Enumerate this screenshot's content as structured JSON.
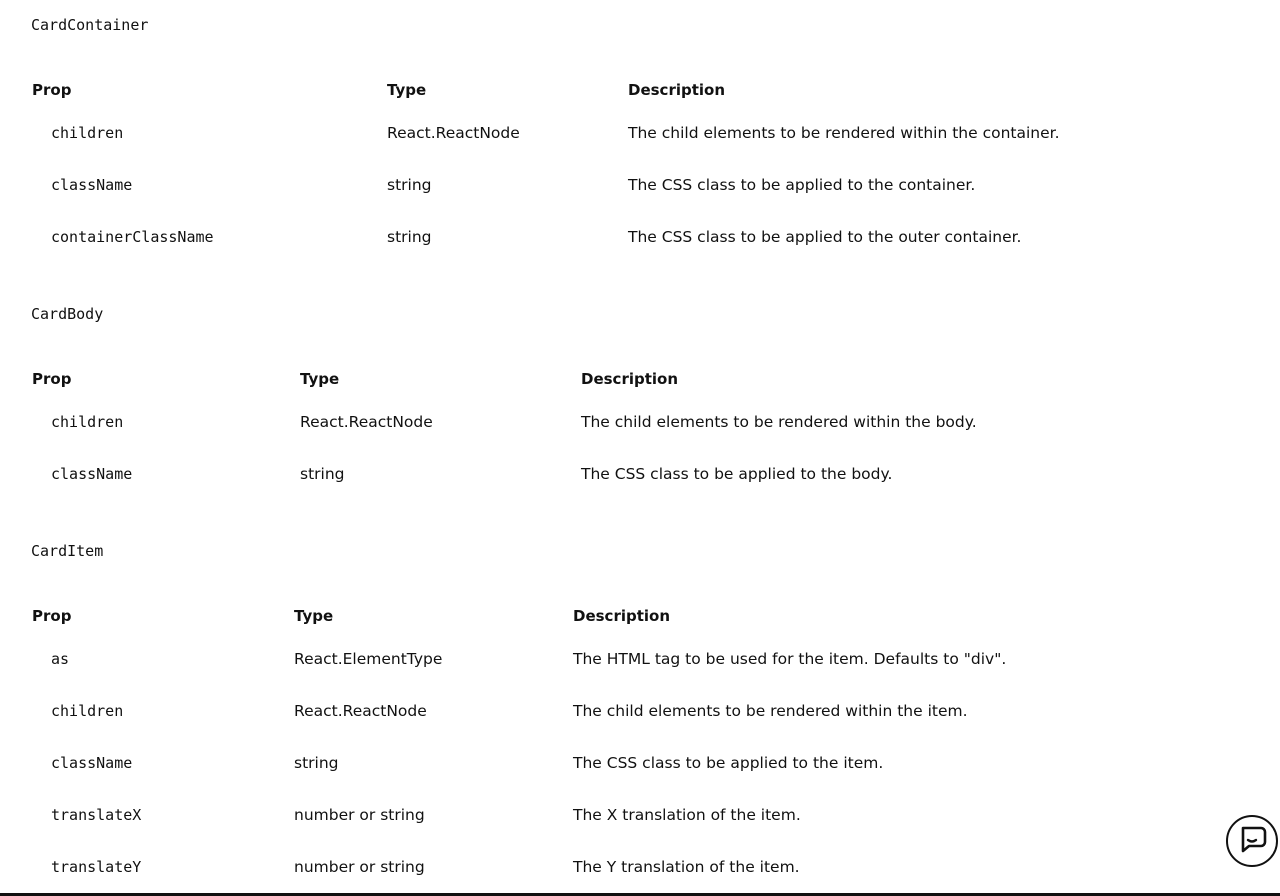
{
  "sections": [
    {
      "title": "CardContainer",
      "headers": [
        "Prop",
        "Type",
        "Description"
      ],
      "rows": [
        {
          "prop": "children",
          "type": "React.ReactNode",
          "description": "The child elements to be rendered within the container."
        },
        {
          "prop": "className",
          "type": "string",
          "description": "The CSS class to be applied to the container."
        },
        {
          "prop": "containerClassName",
          "type": "string",
          "description": "The CSS class to be applied to the outer container."
        }
      ]
    },
    {
      "title": "CardBody",
      "headers": [
        "Prop",
        "Type",
        "Description"
      ],
      "rows": [
        {
          "prop": "children",
          "type": "React.ReactNode",
          "description": "The child elements to be rendered within the body."
        },
        {
          "prop": "className",
          "type": "string",
          "description": "The CSS class to be applied to the body."
        }
      ]
    },
    {
      "title": "CardItem",
      "headers": [
        "Prop",
        "Type",
        "Description"
      ],
      "rows": [
        {
          "prop": "as",
          "type": "React.ElementType",
          "description": "The HTML tag to be used for the item. Defaults to \"div\"."
        },
        {
          "prop": "children",
          "type": "React.ReactNode",
          "description": "The child elements to be rendered within the item."
        },
        {
          "prop": "className",
          "type": "string",
          "description": "The CSS class to be applied to the item."
        },
        {
          "prop": "translateX",
          "type": "number or string",
          "description": "The X translation of the item."
        },
        {
          "prop": "translateY",
          "type": "number or string",
          "description": "The Y translation of the item."
        }
      ]
    }
  ],
  "chat_widget": {
    "icon": "chat-bubble-icon"
  }
}
